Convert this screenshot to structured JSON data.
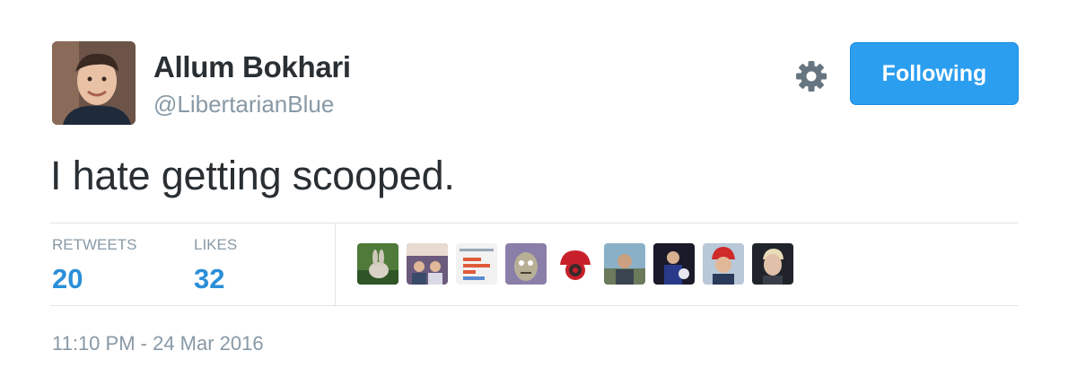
{
  "author": {
    "display_name": "Allum Bokhari",
    "handle": "@LibertarianBlue"
  },
  "actions": {
    "settings_icon": "gear-icon",
    "follow_label": "Following",
    "accent_color": "#2b9ef0"
  },
  "tweet": {
    "text": "I hate getting scooped."
  },
  "stats": {
    "retweets_label": "RETWEETS",
    "retweets_count": "20",
    "likes_label": "LIKES",
    "likes_count": "32"
  },
  "likers": [
    {
      "icon": "rabbit-avatar"
    },
    {
      "icon": "group-photo-avatar"
    },
    {
      "icon": "chart-avatar"
    },
    {
      "icon": "cartoon-avatar"
    },
    {
      "icon": "red-cap-avatar"
    },
    {
      "icon": "man-photo-avatar"
    },
    {
      "icon": "speaker-avatar"
    },
    {
      "icon": "red-hat-man-avatar"
    },
    {
      "icon": "portrait-avatar"
    }
  ],
  "meta": {
    "timestamp": "11:10 PM - 24 Mar 2016"
  }
}
